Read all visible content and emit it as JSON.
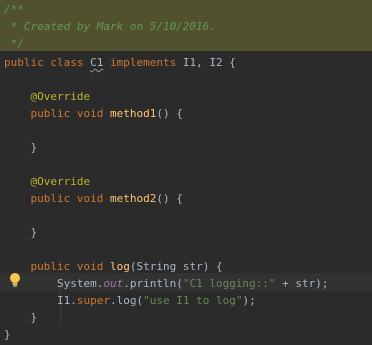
{
  "code": {
    "doc_open": "/**",
    "doc_text": " * Created by Mark on 5/10/2016.",
    "doc_close": " */",
    "class_kw": "public class ",
    "class_name": "C1",
    "implements_kw": " implements ",
    "interfaces": "I1, I2 {",
    "override1": "@Override",
    "m1_kw": "public void ",
    "m1_name": "method1",
    "m1_rest": "() {",
    "close1": "}",
    "override2": "@Override",
    "m2_kw": "public void ",
    "m2_name": "method2",
    "m2_rest": "() {",
    "close2": "}",
    "log_kw": "public void ",
    "log_name": "log",
    "log_rest": "(String str) {",
    "println_pre": "System.",
    "println_field": "out",
    "println_mid": ".println(",
    "println_str": "\"C1 logging::\"",
    "println_post": " + str);",
    "super_pre": "I1.",
    "super_kw": "super",
    "super_mid": ".log(",
    "super_str": "\"use I1 to log\"",
    "super_post": ");",
    "close_log": "}",
    "close_class": "}"
  },
  "colors": {
    "background": "#2b2b2b",
    "doc_band": "#51512f",
    "keyword": "#cc7832",
    "annotation": "#bbb529",
    "method_name": "#ffc66d",
    "string": "#6a8759",
    "static_field": "#9876aa",
    "doc_comment": "#629755",
    "text": "#a9b7c6"
  },
  "icons": {
    "intention_bulb": "lightbulb-icon"
  }
}
